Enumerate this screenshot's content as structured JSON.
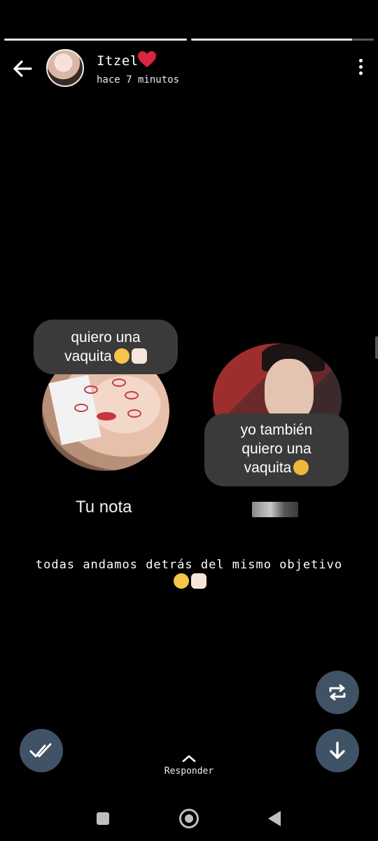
{
  "story": {
    "progress": [
      1.0,
      0.88
    ],
    "user_name": "Itzel",
    "timestamp": "hace 7 minutos",
    "caption": "todas andamos detrás del mismo objetivo",
    "caption_emoji": "😔✊🏻"
  },
  "notes": {
    "left": {
      "bubble_line1": "quiero una",
      "bubble_line2": "vaquita",
      "label": "Tu nota"
    },
    "right": {
      "bubble_line1": "yo también",
      "bubble_line2": "quiero una",
      "bubble_line3": "vaquita"
    }
  },
  "actions": {
    "reply_label": "Responder"
  },
  "icons": {
    "back": "arrow-left-icon",
    "more": "kebab-menu-icon",
    "repost": "repost-icon",
    "seen": "double-check-icon",
    "download": "arrow-down-icon"
  },
  "colors": {
    "background": "#000000",
    "fab": "#3f5266",
    "bubble": "#3a3a3a",
    "heart": "#d7263d"
  }
}
